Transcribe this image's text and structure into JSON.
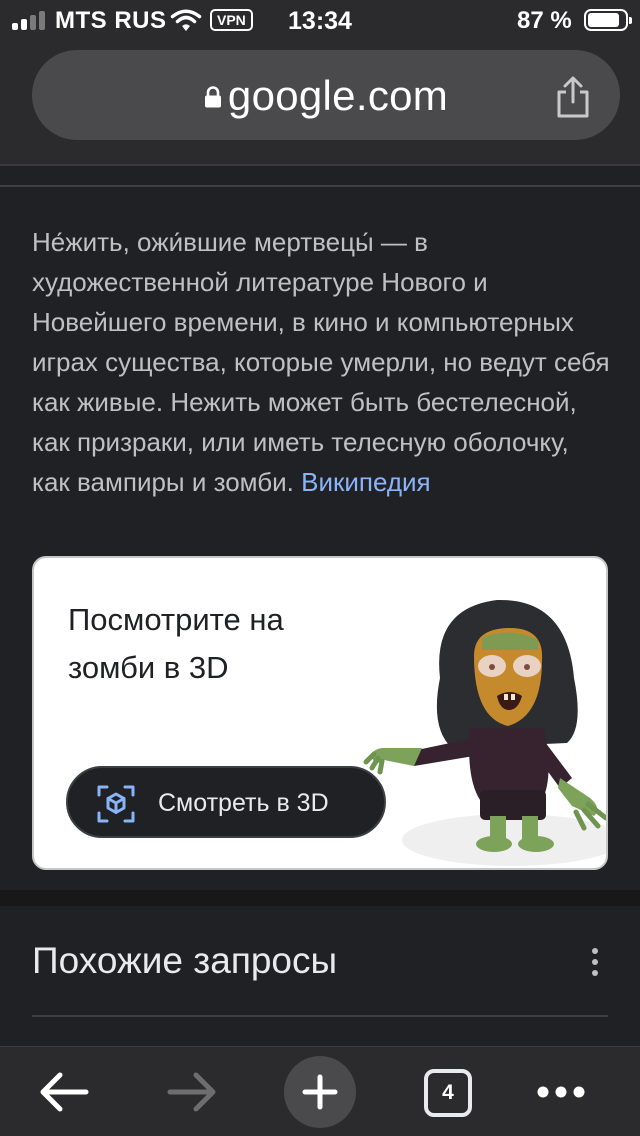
{
  "status_bar": {
    "carrier": "MTS RUS",
    "vpn": "VPN",
    "time": "13:34",
    "battery": "87 %",
    "battery_level": 0.87
  },
  "browser": {
    "url": "google.com",
    "icons": [
      "lock-icon",
      "share-icon"
    ]
  },
  "snippet": {
    "text": "Не́жить, ожи́вшие мертвецы́ — в художественной литературе Нового и Новейшего времени, в кино и компьютерных играх существа, которые умерли, но ведут себя как живые. Нежить может быть бестелесной, как призраки, или иметь телесную оболочку, как вампиры и зомби. ",
    "source_link": "Википедия"
  },
  "card_3d": {
    "title": "Посмотрите на зомби в 3D",
    "button_label": "Смотреть в 3D",
    "accent_color": "#8ab4f8"
  },
  "related": {
    "title": "Похожие запросы"
  },
  "toolbar": {
    "tab_count": "4",
    "icons": [
      "back-icon",
      "forward-icon",
      "new-tab-icon",
      "tabs-icon",
      "more-icon"
    ]
  },
  "colors": {
    "background": "#202124",
    "chrome": "#2b2b2d",
    "text": "#bdc1c6",
    "link": "#8ab4f8"
  }
}
